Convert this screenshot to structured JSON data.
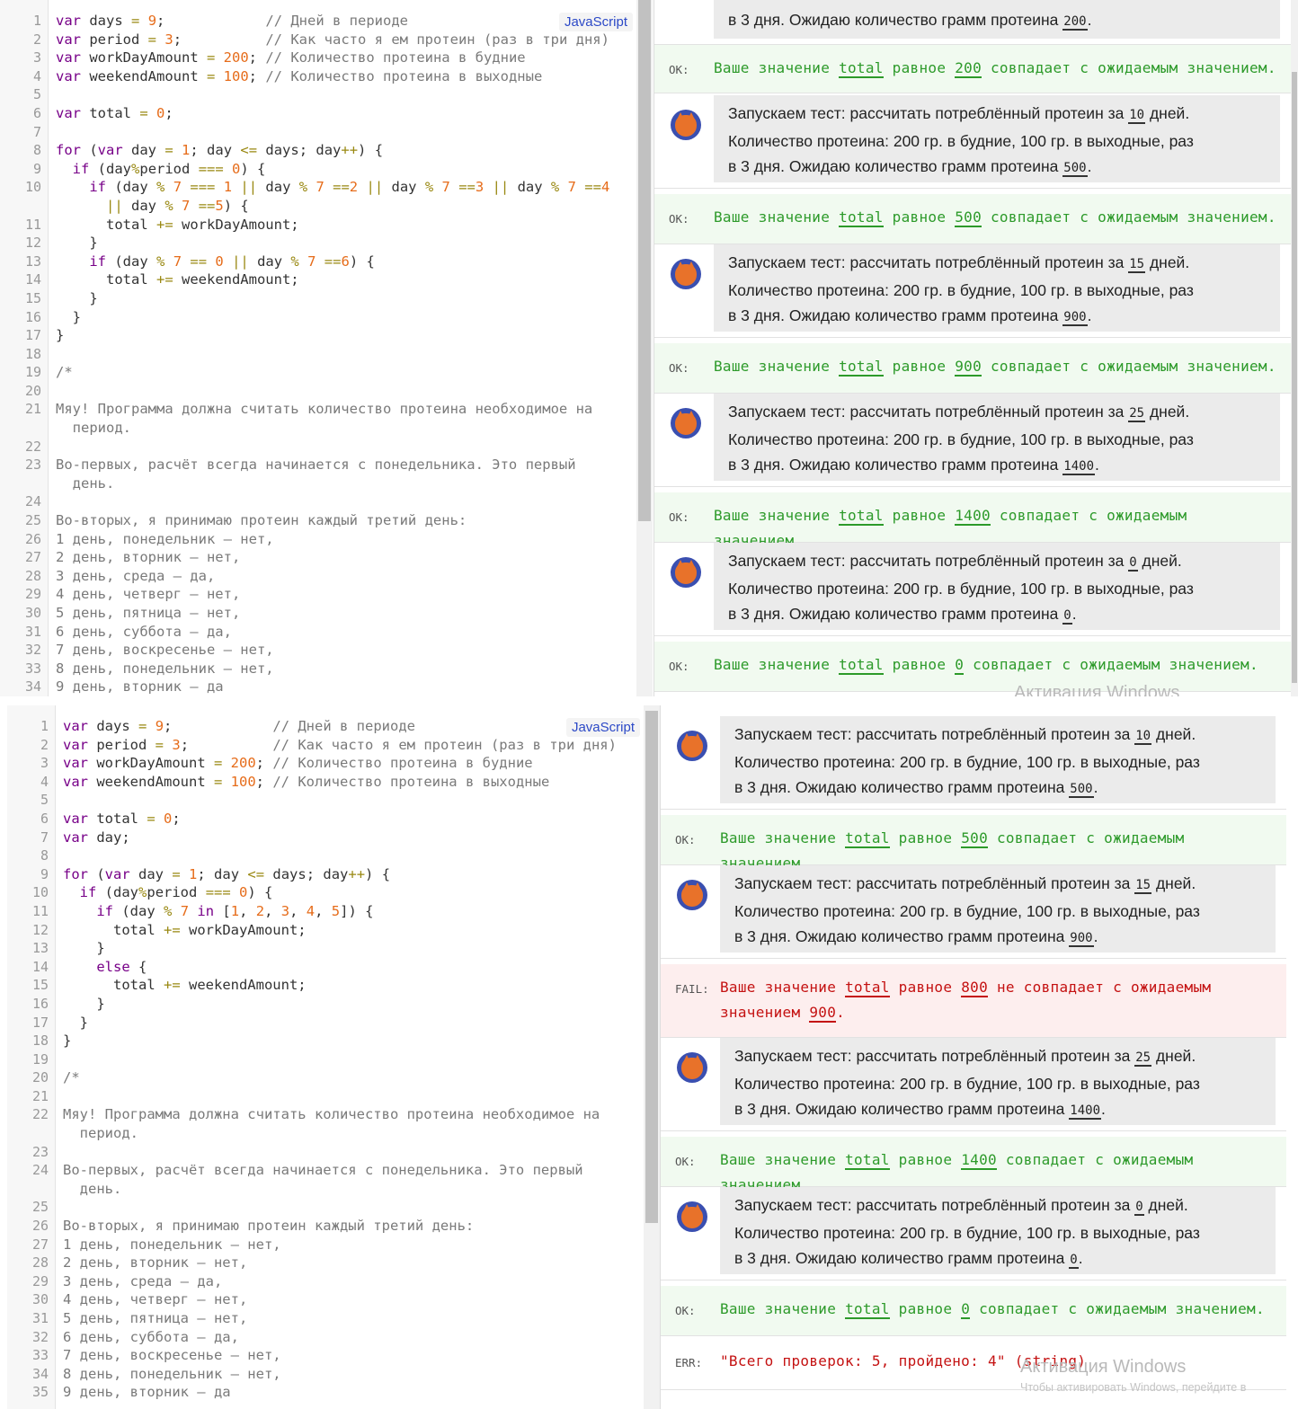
{
  "editor_top": {
    "language_badge": "JavaScript",
    "lines": [
      [
        "1",
        "var days = 9;            // Дней в периоде"
      ],
      [
        "2",
        "var period = 3;          // Как часто я ем протеин (раз в три дня)"
      ],
      [
        "3",
        "var workDayAmount = 200; // Количество протеина в будние"
      ],
      [
        "4",
        "var weekendAmount = 100; // Количество протеина в выходные"
      ],
      [
        "5",
        ""
      ],
      [
        "6",
        "var total = 0;"
      ],
      [
        "7",
        ""
      ],
      [
        "8",
        "for (var day = 1; day <= days; day++) {"
      ],
      [
        "9",
        "  if (day%period === 0) {"
      ],
      [
        "10",
        "    if (day % 7 === 1 || day % 7 ==2 || day % 7 ==3 || day % 7 ==4"
      ],
      [
        "",
        "      || day % 7 ==5) {"
      ],
      [
        "11",
        "      total += workDayAmount;"
      ],
      [
        "12",
        "    }"
      ],
      [
        "13",
        "    if (day % 7 == 0 || day % 7 ==6) {"
      ],
      [
        "14",
        "      total += weekendAmount;"
      ],
      [
        "15",
        "    }"
      ],
      [
        "16",
        "  }"
      ],
      [
        "17",
        "}"
      ],
      [
        "18",
        ""
      ],
      [
        "19",
        "/*"
      ],
      [
        "20",
        ""
      ],
      [
        "21",
        "Мяу! Программа должна считать количество протеина необходимое на"
      ],
      [
        "",
        "  период."
      ],
      [
        "22",
        ""
      ],
      [
        "23",
        "Во-первых, расчёт всегда начинается с понедельника. Это первый"
      ],
      [
        "",
        "  день."
      ],
      [
        "24",
        ""
      ],
      [
        "25",
        "Во-вторых, я принимаю протеин каждый третий день:"
      ],
      [
        "26",
        "1 день, понедельник — нет,"
      ],
      [
        "27",
        "2 день, вторник — нет,"
      ],
      [
        "28",
        "3 день, среда — да,"
      ],
      [
        "29",
        "4 день, четверг — нет,"
      ],
      [
        "30",
        "5 день, пятница — нет,"
      ],
      [
        "31",
        "6 день, суббота — да,"
      ],
      [
        "32",
        "7 день, воскресенье — нет,"
      ],
      [
        "33",
        "8 день, понедельник — нет,"
      ],
      [
        "34",
        "9 день, вторник — да"
      ]
    ]
  },
  "editor_bottom": {
    "language_badge": "JavaScript",
    "lines": [
      [
        "1",
        "var days = 9;            // Дней в периоде"
      ],
      [
        "2",
        "var period = 3;          // Как часто я ем протеин (раз в три дня)"
      ],
      [
        "3",
        "var workDayAmount = 200; // Количество протеина в будние"
      ],
      [
        "4",
        "var weekendAmount = 100; // Количество протеина в выходные"
      ],
      [
        "5",
        ""
      ],
      [
        "6",
        "var total = 0;"
      ],
      [
        "7",
        "var day;"
      ],
      [
        "8",
        ""
      ],
      [
        "9",
        "for (var day = 1; day <= days; day++) {"
      ],
      [
        "10",
        "  if (day%period === 0) {"
      ],
      [
        "11",
        "    if (day % 7 in [1, 2, 3, 4, 5]) {"
      ],
      [
        "12",
        "      total += workDayAmount;"
      ],
      [
        "13",
        "    }"
      ],
      [
        "14",
        "    else {"
      ],
      [
        "15",
        "      total += weekendAmount;"
      ],
      [
        "16",
        "    }"
      ],
      [
        "17",
        "  }"
      ],
      [
        "18",
        "}"
      ],
      [
        "19",
        ""
      ],
      [
        "20",
        "/*"
      ],
      [
        "21",
        ""
      ],
      [
        "22",
        "Мяу! Программа должна считать количество протеина необходимое на"
      ],
      [
        "",
        "  период."
      ],
      [
        "23",
        ""
      ],
      [
        "24",
        "Во-первых, расчёт всегда начинается с понедельника. Это первый"
      ],
      [
        "",
        "  день."
      ],
      [
        "25",
        ""
      ],
      [
        "26",
        "Во-вторых, я принимаю протеин каждый третий день:"
      ],
      [
        "27",
        "1 день, понедельник — нет,"
      ],
      [
        "28",
        "2 день, вторник — нет,"
      ],
      [
        "29",
        "3 день, среда — да,"
      ],
      [
        "30",
        "4 день, четверг — нет,"
      ],
      [
        "31",
        "5 день, пятница — нет,"
      ],
      [
        "32",
        "6 день, суббота — да,"
      ],
      [
        "33",
        "7 день, воскресенье — нет,"
      ],
      [
        "34",
        "8 день, понедельник — нет,"
      ],
      [
        "35",
        "9 день, вторник — да"
      ]
    ]
  },
  "results_top": {
    "first_partial": {
      "pre": "в 3 дня. Ожидаю количество грамм протеина ",
      "value": "200",
      "post": "."
    },
    "tests": [
      {
        "days": "10",
        "expected": "500",
        "result": "500"
      },
      {
        "days": "15",
        "expected": "900",
        "result": "900"
      },
      {
        "days": "25",
        "expected": "1400",
        "result": "1400"
      },
      {
        "days": "0",
        "expected": "0",
        "result": "0"
      }
    ],
    "first_ok_value": "200"
  },
  "results_bottom": {
    "tests": [
      {
        "days": "10",
        "expected": "500",
        "status": "ok",
        "result": "500"
      },
      {
        "days": "15",
        "expected": "900",
        "status": "fail",
        "result": "800"
      },
      {
        "days": "25",
        "expected": "1400",
        "status": "ok",
        "result": "1400"
      },
      {
        "days": "0",
        "expected": "0",
        "status": "ok",
        "result": "0"
      }
    ],
    "err_text": "\"Всего проверок: 5, пройдено: 4\" (string)"
  },
  "strings": {
    "test_prefix": "Запускаем тест: рассчитать потреблённый протеин за ",
    "test_days_suffix": " дней.",
    "test_line2": "Количество протеина: 200 гр. в будние, 100 гр. в выходные, раз",
    "test_line3_pre": "в 3 дня. Ожидаю количество грамм протеина ",
    "ok_tag": "OK:",
    "fail_tag": "FAIL:",
    "err_tag": "ERR:",
    "ok_pre": "Ваше значение ",
    "var_name": "total",
    "ok_mid": " равное ",
    "ok_post": " совпадает с ожидаемым значением.",
    "fail_mid": " не совпадает с ожидаемым значением"
  },
  "watermark": {
    "title": "Активация Windows",
    "subtitle": "Чтобы активировать Windows, перейдите в"
  }
}
